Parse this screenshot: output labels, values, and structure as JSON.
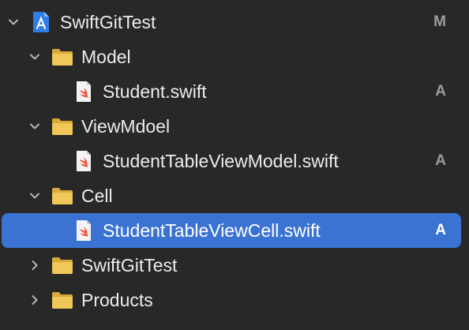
{
  "project": {
    "name": "SwiftGitTest",
    "status": "M",
    "icon": "xcode-project-icon",
    "expanded": true
  },
  "groups": [
    {
      "name": "Model",
      "expanded": true,
      "files": [
        {
          "name": "Student.swift",
          "status": "A"
        }
      ]
    },
    {
      "name": "ViewMdoel",
      "expanded": true,
      "files": [
        {
          "name": "StudentTableViewModel.swift",
          "status": "A"
        }
      ]
    },
    {
      "name": "Cell",
      "expanded": true,
      "files": [
        {
          "name": "StudentTableViewCell.swift",
          "status": "A",
          "selected": true
        }
      ]
    },
    {
      "name": "SwiftGitTest",
      "expanded": false,
      "files": []
    },
    {
      "name": "Products",
      "expanded": false,
      "files": []
    }
  ],
  "colors": {
    "background": "#282828",
    "selection": "#3a73d2",
    "folder": "#e8bd4f",
    "swift": "#f05138",
    "status_badge": "#9c9c9c"
  }
}
